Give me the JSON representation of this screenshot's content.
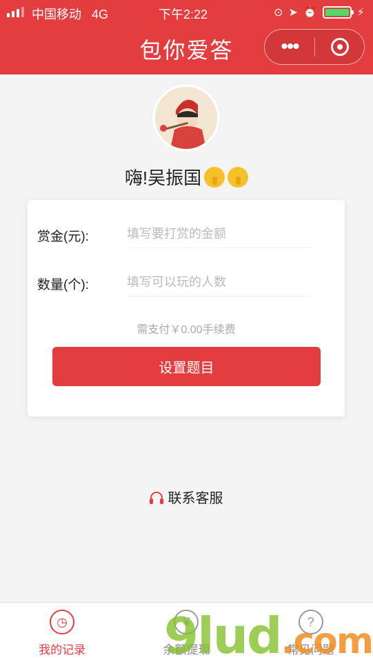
{
  "status_bar": {
    "carrier": "中国移动",
    "network": "4G",
    "time": "下午2:22",
    "battery_level": 1.0
  },
  "nav": {
    "title": "包你爱答",
    "more_icon": "more-dots-icon",
    "close_icon": "target-close-icon"
  },
  "profile": {
    "greeting": "嗨!吴振国"
  },
  "form": {
    "reward_label": "赏金(元):",
    "reward_placeholder": "填写要打赏的金额",
    "count_label": "数量(个):",
    "count_placeholder": "填写可以玩的人数",
    "fee_text": "需支付￥0.00手续费",
    "submit_label": "设置题目"
  },
  "contact": {
    "label": "联系客服"
  },
  "tabbar": {
    "items": [
      {
        "label": "我的记录",
        "icon": "history-clock-icon",
        "active": true
      },
      {
        "label": "余额提现",
        "icon": "withdraw-icon",
        "active": false
      },
      {
        "label": "常见问题",
        "icon": "question-icon",
        "active": false
      }
    ]
  },
  "watermark": {
    "text": "9lud",
    "suffix": ".com"
  },
  "colors": {
    "brand": "#e43d3f",
    "background": "#f4f4f4"
  }
}
